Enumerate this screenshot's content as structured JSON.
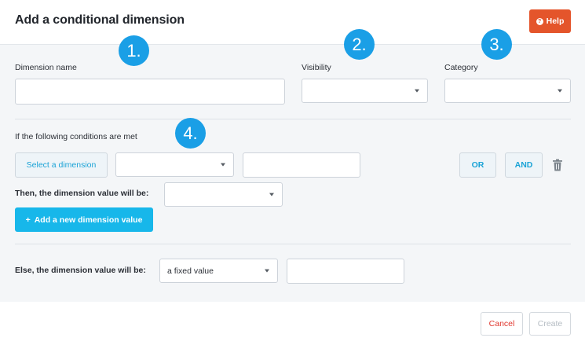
{
  "dialog": {
    "title": "Add a conditional dimension",
    "help_label": "Help"
  },
  "fields": {
    "dimension_name_label": "Dimension name",
    "dimension_name_value": "",
    "visibility_label": "Visibility",
    "visibility_value": "",
    "category_label": "Category",
    "category_value": ""
  },
  "conditions": {
    "heading": "If the following conditions are met",
    "select_dimension_label": "Select a dimension",
    "operator_value": "",
    "condition_value": "",
    "or_label": "OR",
    "and_label": "AND",
    "then_label": "Then, the dimension value will be:",
    "then_value": "",
    "add_value_label": "Add a new dimension value",
    "add_value_plus": "+"
  },
  "else_section": {
    "label": "Else, the dimension value will be:",
    "mode_value": "a fixed value",
    "fixed_value": ""
  },
  "footer": {
    "cancel_label": "Cancel",
    "create_label": "Create"
  },
  "annotations": [
    "1.",
    "2.",
    "3.",
    "4."
  ],
  "colors": {
    "accent": "#17b7ea",
    "help": "#e4552b",
    "cancel": "#e0362d",
    "badge": "#1a9fe6"
  }
}
